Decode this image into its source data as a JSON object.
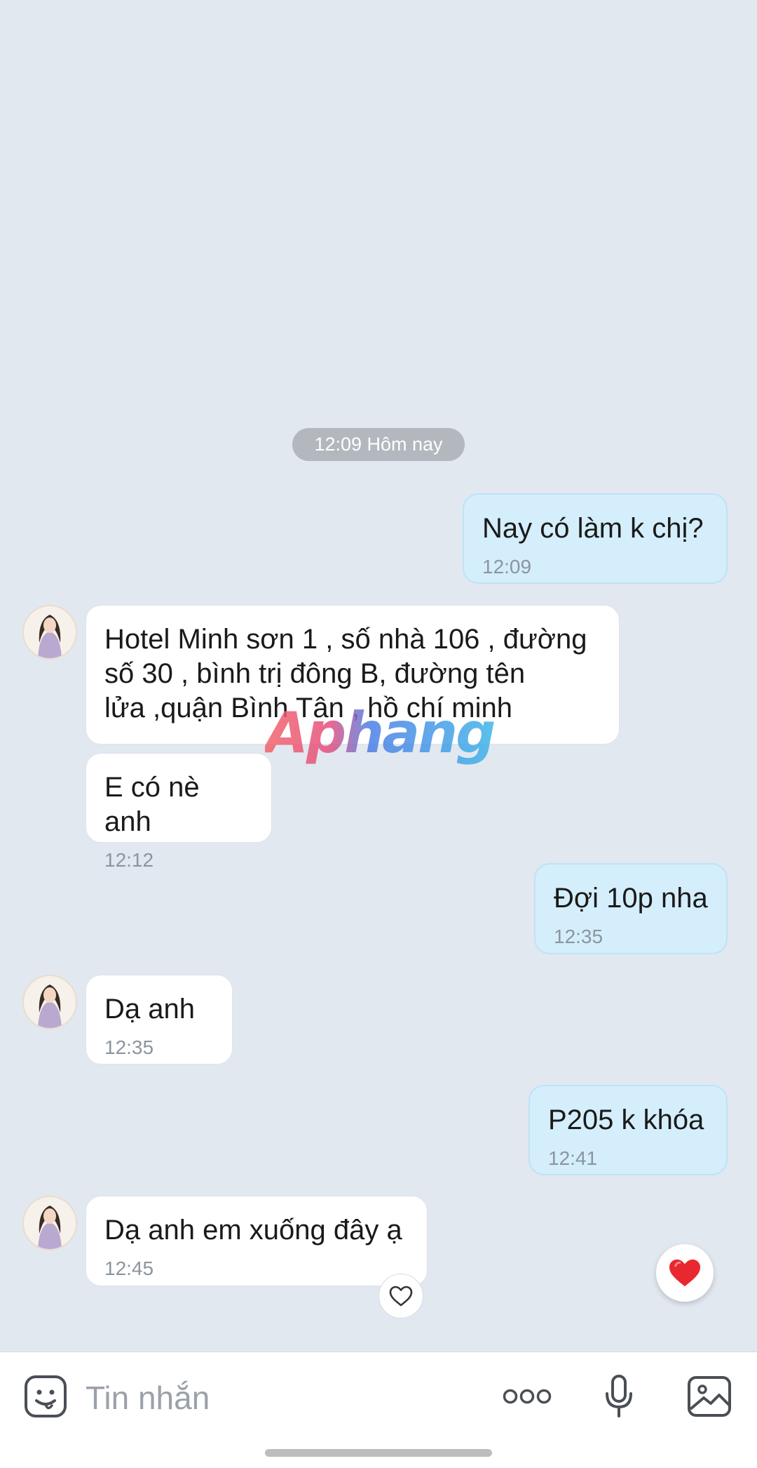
{
  "conversation": {
    "date_separator": "12:09 Hôm nay",
    "messages": [
      {
        "direction": "outgoing",
        "text": "Nay có làm k chị?",
        "time": "12:09"
      },
      {
        "direction": "incoming",
        "text": "Hotel Minh sơn 1 , số nhà 106 , đường\nsố 30 , bình trị đông B, đường tên\nlửa ,quận Bình Tân , hồ chí minh",
        "time": ""
      },
      {
        "direction": "incoming",
        "text": "E có nè anh",
        "time": "12:12"
      },
      {
        "direction": "outgoing",
        "text": "Đợi 10p nha",
        "time": "12:35"
      },
      {
        "direction": "incoming",
        "text": "Dạ anh",
        "time": "12:35"
      },
      {
        "direction": "outgoing",
        "text": "P205 k khóa",
        "time": "12:41"
      },
      {
        "direction": "incoming",
        "text": "Dạ anh em xuống đây ạ",
        "time": "12:45"
      }
    ]
  },
  "watermark": {
    "text": "Aphang"
  },
  "reactions": {
    "react_icon": "heart-outline-icon",
    "quick_heart_icon": "heart-filled-icon",
    "heart_color": "#e8282e"
  },
  "composer": {
    "placeholder": "Tin nhắn",
    "icons": [
      "emoji-icon",
      "more-dots-icon",
      "microphone-icon",
      "gallery-icon"
    ]
  },
  "colors": {
    "background": "#e2e8f0",
    "outgoing_bubble": "#d4eefb",
    "incoming_bubble": "#ffffff"
  }
}
